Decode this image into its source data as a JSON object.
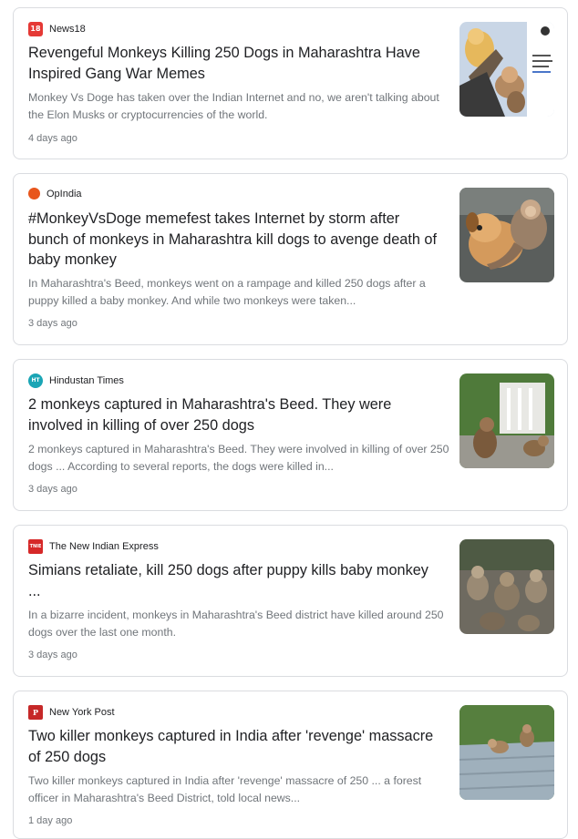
{
  "articles": [
    {
      "source": "News18",
      "source_icon": "18",
      "source_color": "#e53935",
      "title": "Revengeful Monkeys Killing 250 Dogs in Maharashtra Have Inspired Gang War Memes",
      "snippet": "Monkey Vs Doge has taken over the Indian Internet and no, we aren't talking about the Elon Musks or cryptocurrencies of the world.",
      "date": "4 days ago",
      "thumbnail": "doge-monkey-meme-image"
    },
    {
      "source": "OpIndia",
      "source_icon": "",
      "source_color": "#e8561c",
      "title": "#MonkeyVsDoge memefest takes Internet by storm after bunch of monkeys in Maharashtra kill dogs to avenge death of baby monkey",
      "snippet": "In Maharashtra's Beed, monkeys went on a rampage and killed 250 dogs after a puppy killed a baby monkey. And while two monkeys were taken...",
      "date": "3 days ago",
      "thumbnail": "monkey-holding-puppy-image"
    },
    {
      "source": "Hindustan Times",
      "source_icon": "HT",
      "source_color": "#1aa5b5",
      "title": "2 monkeys captured in Maharashtra's Beed. They were involved in killing of over 250 dogs",
      "snippet": "2 monkeys captured in Maharashtra's Beed. They were involved in killing of over 250 dogs ... According to several reports, the dogs were killed in...",
      "date": "3 days ago",
      "thumbnail": "monkeys-on-road-image"
    },
    {
      "source": "The New Indian Express",
      "source_icon": "TNIE",
      "source_color": "#d62828",
      "title": "Simians retaliate, kill 250 dogs after puppy kills baby monkey ...",
      "snippet": "In a bizarre incident, monkeys in Maharashtra's Beed district have killed around 250 dogs over the last one month.",
      "date": "3 days ago",
      "thumbnail": "monkey-troop-image"
    },
    {
      "source": "New York Post",
      "source_icon": "P",
      "source_color": "#c62828",
      "title": "Two killer monkeys captured in India after 'revenge' massacre of 250 dogs",
      "snippet": "Two killer monkeys captured in India after 'revenge' massacre of 250 ... a forest officer in Maharashtra's Beed District, told local news...",
      "date": "1 day ago",
      "thumbnail": "monkeys-on-roof-image"
    }
  ]
}
